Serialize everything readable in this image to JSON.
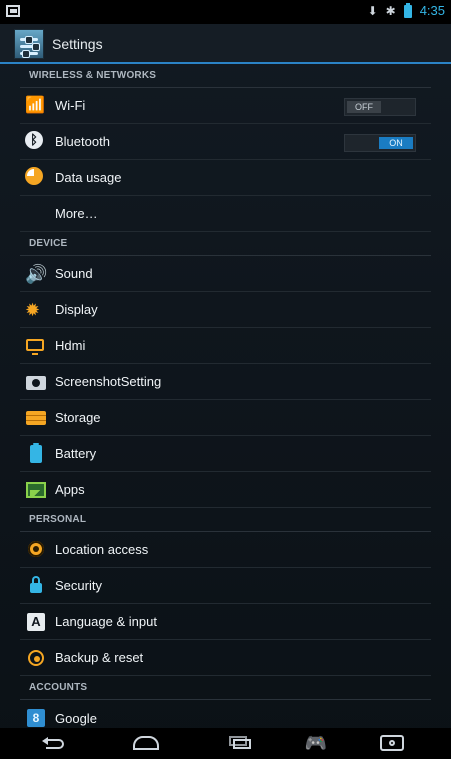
{
  "status_bar": {
    "time": "4:35",
    "icons": [
      "notification-icon",
      "download-icon",
      "battery-icon"
    ]
  },
  "action_bar": {
    "title": "Settings",
    "app_icon": "settings-sliders-icon"
  },
  "sections": [
    {
      "header": "WIRELESS & NETWORKS",
      "items": [
        {
          "label": "Wi-Fi",
          "icon": "wifi-icon",
          "toggle": "OFF"
        },
        {
          "label": "Bluetooth",
          "icon": "bluetooth-icon",
          "toggle": "ON"
        },
        {
          "label": "Data usage",
          "icon": "data-usage-icon"
        },
        {
          "label": "More…",
          "icon": ""
        }
      ]
    },
    {
      "header": "DEVICE",
      "items": [
        {
          "label": "Sound",
          "icon": "sound-icon"
        },
        {
          "label": "Display",
          "icon": "display-icon"
        },
        {
          "label": "Hdmi",
          "icon": "hdmi-icon"
        },
        {
          "label": "ScreenshotSetting",
          "icon": "screenshot-icon"
        },
        {
          "label": "Storage",
          "icon": "storage-icon"
        },
        {
          "label": "Battery",
          "icon": "battery-icon"
        },
        {
          "label": "Apps",
          "icon": "apps-icon"
        }
      ]
    },
    {
      "header": "PERSONAL",
      "items": [
        {
          "label": "Location access",
          "icon": "location-icon"
        },
        {
          "label": "Security",
          "icon": "lock-icon"
        },
        {
          "label": "Language & input",
          "icon": "language-icon"
        },
        {
          "label": "Backup & reset",
          "icon": "backup-icon"
        }
      ]
    },
    {
      "header": "ACCOUNTS",
      "items": [
        {
          "label": "Google",
          "icon": "google-icon"
        }
      ]
    }
  ],
  "nav_bar": {
    "buttons": [
      "back-icon",
      "home-icon",
      "recent-apps-icon",
      "gamepad-icon",
      "screenshot-button-icon"
    ]
  },
  "colors": {
    "accent_blue": "#34b5e5",
    "accent_orange": "#f5a623",
    "divider": "#2b83c6",
    "background": "#0f161d"
  }
}
